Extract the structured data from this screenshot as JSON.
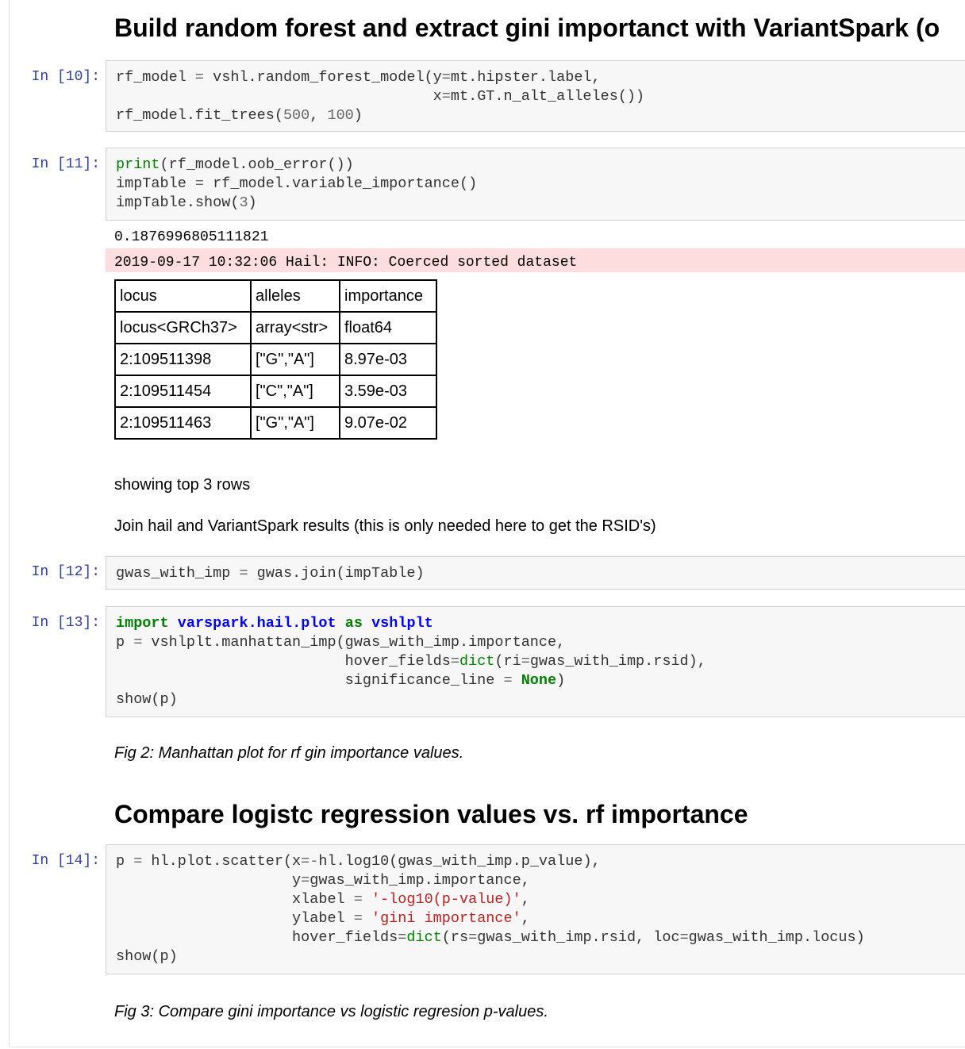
{
  "heading1": "Build random forest and extract gini importanct with VariantSpark (o",
  "cells": [
    {
      "prompt": "In [10]:",
      "lines": [
        "rf_model = vshl.random_forest_model(y=mt.hipster.label,",
        "                                    x=mt.GT.n_alt_alleles())",
        "rf_model.fit_trees(500, 100)"
      ]
    },
    {
      "prompt": "In [11]:",
      "lines": [
        "print(rf_model.oob_error())",
        "impTable = rf_model.variable_importance()",
        "impTable.show(3)"
      ]
    },
    {
      "prompt": "In [12]:",
      "lines": [
        "gwas_with_imp = gwas.join(impTable)"
      ]
    },
    {
      "prompt": "In [13]:",
      "lines": [
        "import varspark.hail.plot as vshlplt",
        "p = vshlplt.manhattan_imp(gwas_with_imp.importance,",
        "                          hover_fields=dict(ri=gwas_with_imp.rsid),",
        "                          significance_line = None)",
        "show(p)"
      ]
    },
    {
      "prompt": "In [14]:",
      "lines": [
        "p = hl.plot.scatter(x=-hl.log10(gwas_with_imp.p_value),",
        "                    y=gwas_with_imp.importance,",
        "                    xlabel = '-log10(p-value)',",
        "                    ylabel = 'gini importance',",
        "                    hover_fields=dict(rs=gwas_with_imp.rsid, loc=gwas_with_imp.locus)",
        "show(p)"
      ]
    }
  ],
  "output11": {
    "oob_error": "0.1876996805111821",
    "log": "2019-09-17 10:32:06 Hail: INFO: Coerced sorted dataset",
    "table": {
      "headers": [
        "locus",
        "alleles",
        "importance"
      ],
      "types": [
        "locus<GRCh37>",
        "array<str>",
        "float64"
      ],
      "rows": [
        [
          "2:109511398",
          "[\"G\",\"A\"]",
          "8.97e-03"
        ],
        [
          "2:109511454",
          "[\"C\",\"A\"]",
          "3.59e-03"
        ],
        [
          "2:109511463",
          "[\"G\",\"A\"]",
          "9.07e-02"
        ]
      ]
    },
    "showing": "showing top 3 rows"
  },
  "md_join": "Join hail and VariantSpark results (this is only needed here to get the RSID's)",
  "fig2_caption": "Fig 2: Manhattan plot for rf gin importance values.",
  "heading2": "Compare logistc regression values vs. rf importance",
  "fig3_caption": "Fig 3: Compare gini importance vs logistic regresion p-values."
}
